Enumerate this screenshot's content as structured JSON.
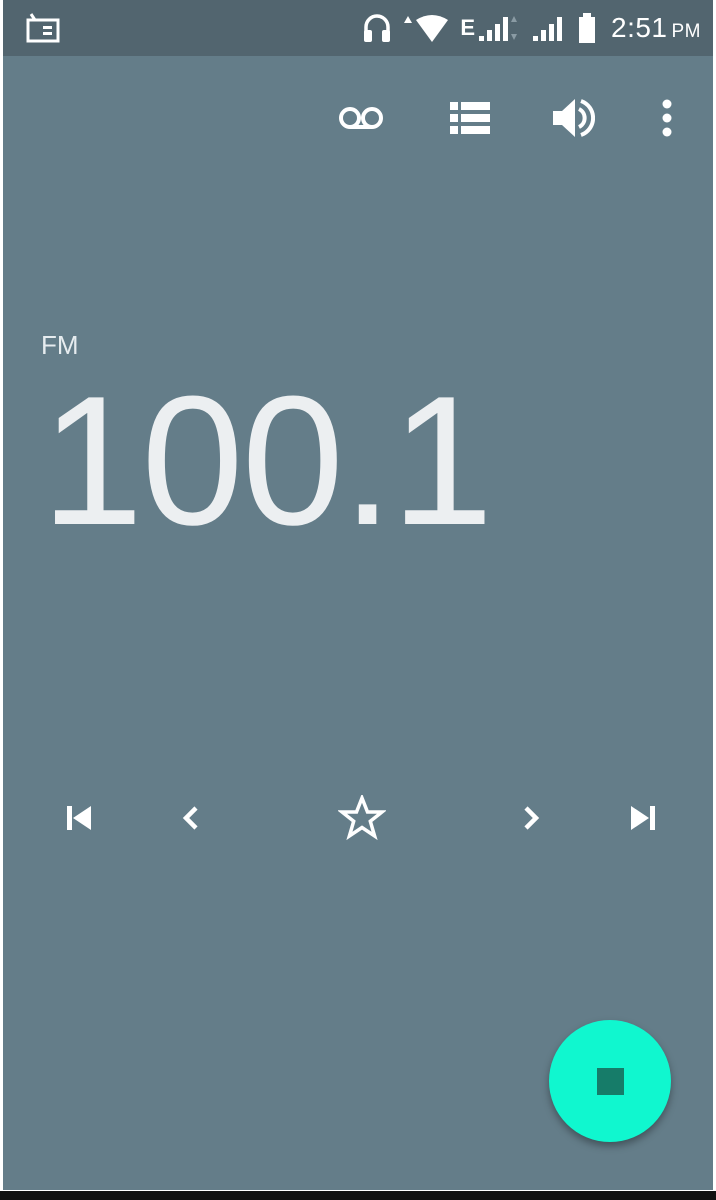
{
  "status_bar": {
    "time": "2:51",
    "ampm": "PM",
    "network_label": "E",
    "icons": [
      "radio-app-icon",
      "headset-icon",
      "wifi-icon",
      "signal-icon",
      "signal-icon",
      "battery-icon"
    ]
  },
  "toolbar": {
    "actions": [
      "record-icon",
      "station-list-icon",
      "speaker-icon",
      "more-vert-icon"
    ]
  },
  "tuner": {
    "band": "FM",
    "frequency": "100.1"
  },
  "controls": [
    "skip-previous-icon",
    "seek-back-icon",
    "favorite-star-icon",
    "seek-forward-icon",
    "skip-next-icon"
  ],
  "colors": {
    "background": "#647d89",
    "status_bar": "#52656f",
    "fab": "#10f7cf",
    "fab_icon": "#167c69"
  }
}
